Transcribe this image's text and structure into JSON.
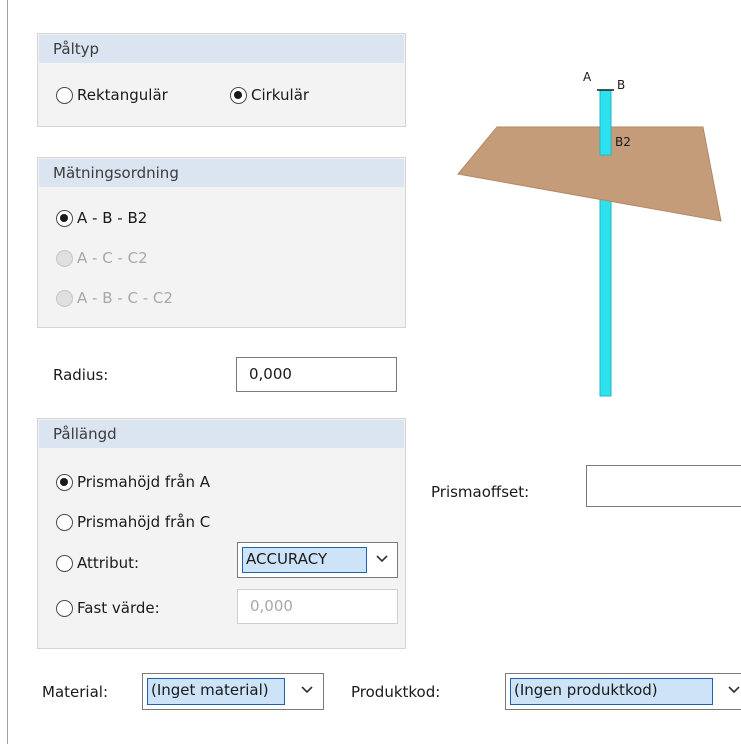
{
  "pile_type": {
    "title": "Påltyp",
    "options": [
      "Rektangulär",
      "Cirkulär"
    ],
    "selected": "Cirkulär"
  },
  "measurement_order": {
    "title": "Mätningsordning",
    "options": [
      "A - B - B2",
      "A - C - C2",
      "A - B - C - C2"
    ],
    "selected": "A - B - B2"
  },
  "radius": {
    "label": "Radius:",
    "value": "0,000"
  },
  "pile_length": {
    "title": "Pållängd",
    "options": [
      "Prismahöjd från A",
      "Prismahöjd från C",
      "Attribut:",
      "Fast värde:"
    ],
    "selected": "Prismahöjd från A",
    "attribute_value": "ACCURACY",
    "fixed_value": "0,000"
  },
  "prism_offset": {
    "label": "Prismaoffset:",
    "value": ""
  },
  "material": {
    "label": "Material:",
    "value": "(Inget material)"
  },
  "product_code": {
    "label": "Produktkod:",
    "value": "(Ingen produktkod)"
  },
  "preview": {
    "labels": [
      "A",
      "B",
      "B2"
    ],
    "plane_color": "#c49c7a",
    "pile_color": "#2de1ee"
  }
}
